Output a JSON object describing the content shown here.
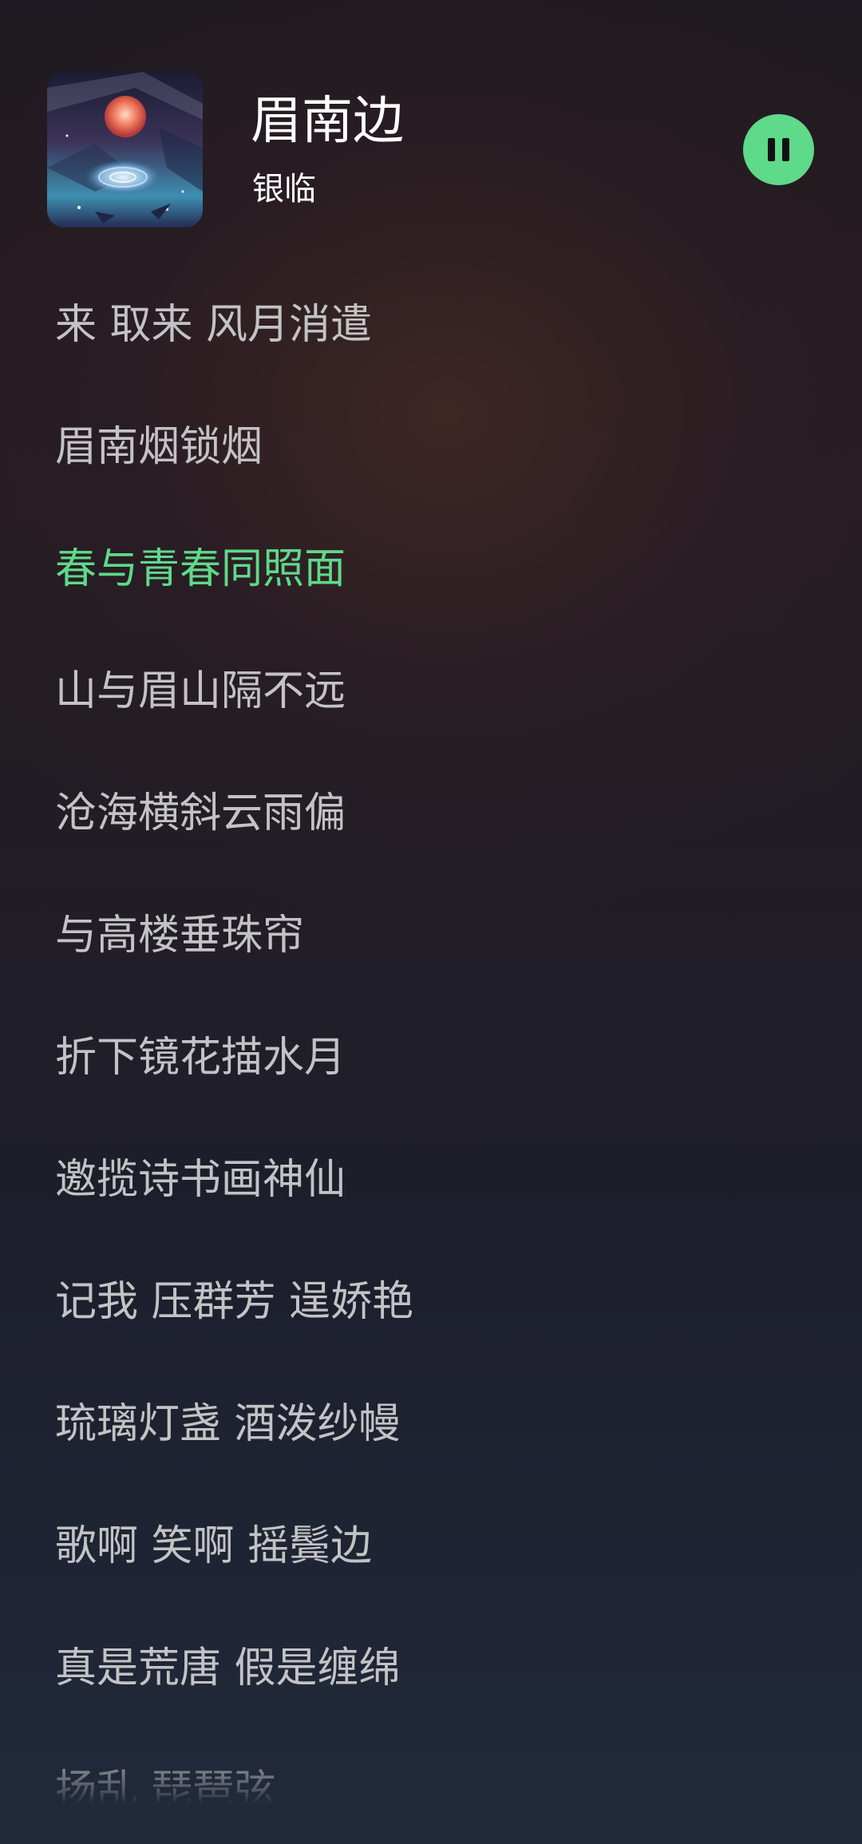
{
  "player": {
    "title": "眉南边",
    "artist": "银临",
    "cover_icon": "album-cover",
    "pause_icon": "pause-icon",
    "accent_color": "#5fd98a"
  },
  "lyrics": {
    "active_index": 2,
    "lines": [
      "来 取来 风月消遣",
      "眉南烟锁烟",
      "春与青春同照面",
      "山与眉山隔不远",
      "沧海横斜云雨偏",
      "与高楼垂珠帘",
      "折下镜花描水月",
      "邀揽诗书画神仙",
      "记我 压群芳 逞娇艳",
      "琉璃灯盏 酒泼纱幔",
      "歌啊 笑啊 摇鬓边",
      "真是荒唐 假是缠绵",
      "扬乱 琵琶弦"
    ]
  }
}
